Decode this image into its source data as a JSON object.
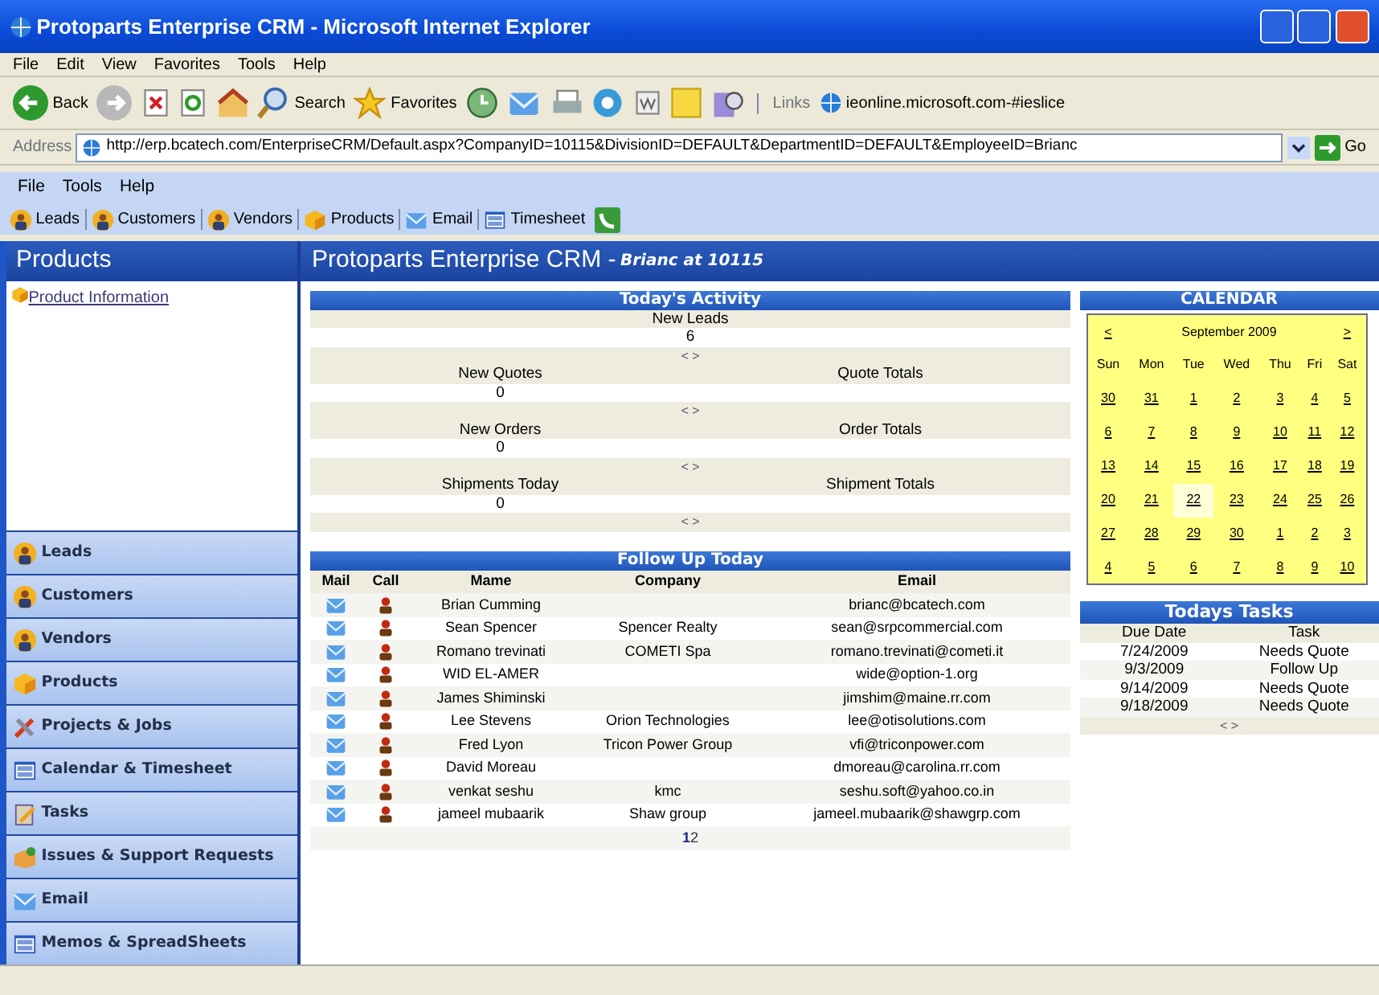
{
  "window": {
    "title": "Protoparts Enterprise CRM - Microsoft Internet Explorer"
  },
  "ie_menu": [
    "File",
    "Edit",
    "View",
    "Favorites",
    "Tools",
    "Help"
  ],
  "ie_toolbar": {
    "back": "Back",
    "search": "Search",
    "favorites": "Favorites",
    "links_label": "Links",
    "link": "ieonline.microsoft.com-#ieslice"
  },
  "address": {
    "label": "Address",
    "url": "http://erp.bcatech.com/EnterpriseCRM/Default.aspx?CompanyID=10115&DivisionID=DEFAULT&DepartmentID=DEFAULT&EmployeeID=Brianc",
    "go": "Go"
  },
  "app_menu": [
    "File",
    "Tools",
    "Help"
  ],
  "app_toolbar": [
    "Leads",
    "Customers",
    "Vendors",
    "Products",
    "Email",
    "Timesheet"
  ],
  "sidebar": {
    "title": "Products",
    "links": [
      "Product Information"
    ],
    "items": [
      {
        "label": "Leads"
      },
      {
        "label": "Customers"
      },
      {
        "label": "Vendors"
      },
      {
        "label": "Products"
      },
      {
        "label": "Projects & Jobs"
      },
      {
        "label": "Calendar & Timesheet"
      },
      {
        "label": "Tasks"
      },
      {
        "label": "Issues & Support Requests"
      },
      {
        "label": "Email"
      },
      {
        "label": "Memos & SpreadSheets"
      }
    ]
  },
  "header": {
    "title": "Protoparts Enterprise CRM - ",
    "user": "Brianc at 10115"
  },
  "activity": {
    "title": "Today's Activity",
    "sections": [
      {
        "label": "New Leads",
        "value": "6",
        "pager": "< >"
      },
      {
        "label": "New Quotes",
        "value": "0",
        "totals": "Quote Totals",
        "pager": "< >"
      },
      {
        "label": "New Orders",
        "value": "0",
        "totals": "Order Totals",
        "pager": "< >"
      },
      {
        "label": "Shipments Today",
        "value": "0",
        "totals": "Shipment Totals",
        "pager": "< >"
      }
    ]
  },
  "follow_up": {
    "title": "Follow Up Today",
    "columns": [
      "Mail",
      "Call",
      "Mame",
      "Company",
      "Email"
    ],
    "rows": [
      {
        "name": "Brian Cumming",
        "company": "",
        "email": "brianc@bcatech.com"
      },
      {
        "name": "Sean Spencer",
        "company": "Spencer Realty",
        "email": "sean@srpcommercial.com"
      },
      {
        "name": "Romano trevinati",
        "company": "COMETI Spa",
        "email": "romano.trevinati@cometi.it"
      },
      {
        "name": "WID EL-AMER",
        "company": "",
        "email": "wide@option-1.org"
      },
      {
        "name": "James Shiminski",
        "company": "",
        "email": "jimshim@maine.rr.com"
      },
      {
        "name": "Lee Stevens",
        "company": "Orion Technologies",
        "email": "lee@otisolutions.com"
      },
      {
        "name": "Fred Lyon",
        "company": "Tricon Power Group",
        "email": "vfi@triconpower.com"
      },
      {
        "name": "David Moreau",
        "company": "",
        "email": "dmoreau@carolina.rr.com"
      },
      {
        "name": "venkat seshu",
        "company": "kmc",
        "email": "seshu.soft@yahoo.co.in"
      },
      {
        "name": "jameel mubaarik",
        "company": "Shaw group",
        "email": "jameel.mubaarik@shawgrp.com"
      }
    ],
    "pages": [
      {
        "label": "1",
        "selected": true
      },
      {
        "label": "2",
        "selected": false
      }
    ]
  },
  "calendar": {
    "title": "CALENDAR",
    "prev": "<",
    "month": "September 2009",
    "next": ">",
    "weekdays": [
      "Sun",
      "Mon",
      "Tue",
      "Wed",
      "Thu",
      "Fri",
      "Sat"
    ],
    "weeks": [
      [
        {
          "label": "30",
          "selected": false
        },
        {
          "label": "31",
          "selected": false
        },
        {
          "label": "1",
          "selected": false
        },
        {
          "label": "2",
          "selected": false
        },
        {
          "label": "3",
          "selected": false
        },
        {
          "label": "4",
          "selected": false
        },
        {
          "label": "5",
          "selected": false
        }
      ],
      [
        {
          "label": "6",
          "selected": false
        },
        {
          "label": "7",
          "selected": false
        },
        {
          "label": "8",
          "selected": false
        },
        {
          "label": "9",
          "selected": false
        },
        {
          "label": "10",
          "selected": false
        },
        {
          "label": "11",
          "selected": false
        },
        {
          "label": "12",
          "selected": false
        }
      ],
      [
        {
          "label": "13",
          "selected": false
        },
        {
          "label": "14",
          "selected": false
        },
        {
          "label": "15",
          "selected": false
        },
        {
          "label": "16",
          "selected": false
        },
        {
          "label": "17",
          "selected": false
        },
        {
          "label": "18",
          "selected": false
        },
        {
          "label": "19",
          "selected": false
        }
      ],
      [
        {
          "label": "20",
          "selected": false
        },
        {
          "label": "21",
          "selected": false
        },
        {
          "label": "22",
          "selected": true
        },
        {
          "label": "23",
          "selected": false
        },
        {
          "label": "24",
          "selected": false
        },
        {
          "label": "25",
          "selected": false
        },
        {
          "label": "26",
          "selected": false
        }
      ],
      [
        {
          "label": "27",
          "selected": false
        },
        {
          "label": "28",
          "selected": false
        },
        {
          "label": "29",
          "selected": false
        },
        {
          "label": "30",
          "selected": false
        },
        {
          "label": "1",
          "selected": false
        },
        {
          "label": "2",
          "selected": false
        },
        {
          "label": "3",
          "selected": false
        }
      ],
      [
        {
          "label": "4",
          "selected": false
        },
        {
          "label": "5",
          "selected": false
        },
        {
          "label": "6",
          "selected": false
        },
        {
          "label": "7",
          "selected": false
        },
        {
          "label": "8",
          "selected": false
        },
        {
          "label": "9",
          "selected": false
        },
        {
          "label": "10",
          "selected": false
        }
      ]
    ]
  },
  "tasks": {
    "title": "Todays Tasks",
    "columns": [
      "Due Date",
      "Task"
    ],
    "rows": [
      {
        "due": "7/24/2009",
        "task": "Needs Quote"
      },
      {
        "due": "9/3/2009",
        "task": "Follow Up"
      },
      {
        "due": "9/14/2009",
        "task": "Needs Quote"
      },
      {
        "due": "9/18/2009",
        "task": "Needs Quote"
      }
    ],
    "pager": "< >"
  }
}
